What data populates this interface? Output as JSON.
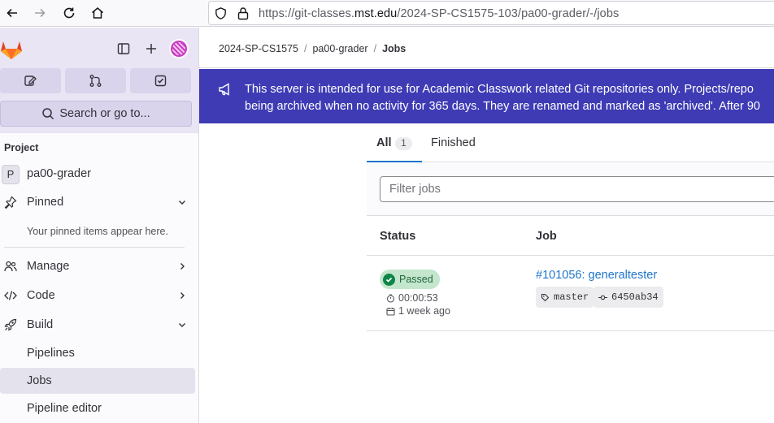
{
  "browser": {
    "url_prefix": "https://git-classes.",
    "url_domain": "mst.edu",
    "url_path": "/2024-SP-CS1575-103/pa00-grader/-/jobs"
  },
  "sidebar": {
    "search_placeholder": "Search or go to...",
    "section_label": "Project",
    "project_initial": "P",
    "project_name": "pa00-grader",
    "pinned_label": "Pinned",
    "pinned_empty": "Your pinned items appear here.",
    "items": [
      {
        "label": "Manage"
      },
      {
        "label": "Code"
      },
      {
        "label": "Build"
      }
    ],
    "build_sub": [
      {
        "label": "Pipelines"
      },
      {
        "label": "Jobs"
      },
      {
        "label": "Pipeline editor"
      }
    ]
  },
  "breadcrumb": {
    "group": "2024-SP-CS1575",
    "project": "pa00-grader",
    "current": "Jobs"
  },
  "banner": {
    "line1": "This server is intended for use for Academic Classwork related Git repositories only. Projects/repo",
    "line2": "being archived when no activity for 365 days. They are renamed and marked as 'archived'. After 90"
  },
  "tabs": {
    "all_label": "All",
    "all_count": "1",
    "finished_label": "Finished"
  },
  "filter": {
    "placeholder": "Filter jobs"
  },
  "table": {
    "headers": {
      "status": "Status",
      "job": "Job"
    },
    "rows": [
      {
        "status": "Passed",
        "duration": "00:00:53",
        "finished": "1 week ago",
        "job": "#101056: generaltester",
        "ref": "master",
        "commit": "6450ab34"
      }
    ]
  },
  "colors": {
    "banner_bg": "#3e3bb5",
    "sidebar_top_bg": "#e9e5f4",
    "success": "#108548",
    "link": "#1f75cb"
  }
}
